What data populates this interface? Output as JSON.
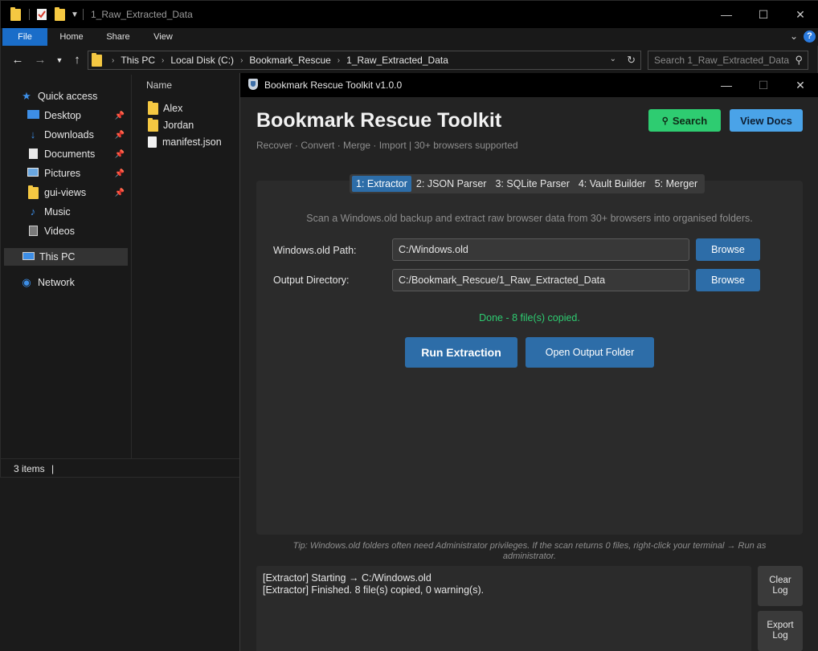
{
  "explorer": {
    "window_title": "1_Raw_Extracted_Data",
    "ribbon_tabs": [
      "File",
      "Home",
      "Share",
      "View"
    ],
    "help_glyph": "?",
    "breadcrumbs": [
      "This PC",
      "Local Disk (C:)",
      "Bookmark_Rescue",
      "1_Raw_Extracted_Data"
    ],
    "search_placeholder": "Search 1_Raw_Extracted_Data",
    "nav_items": [
      {
        "label": "Quick access",
        "icon": "star-icon"
      },
      {
        "label": "Desktop",
        "icon": "desktop-icon",
        "pinned": true
      },
      {
        "label": "Downloads",
        "icon": "download-icon",
        "pinned": true
      },
      {
        "label": "Documents",
        "icon": "document-icon",
        "pinned": true
      },
      {
        "label": "Pictures",
        "icon": "picture-icon",
        "pinned": true
      },
      {
        "label": "gui-views",
        "icon": "folder-icon",
        "pinned": true
      },
      {
        "label": "Music",
        "icon": "music-icon"
      },
      {
        "label": "Videos",
        "icon": "video-icon"
      },
      {
        "label": "This PC",
        "icon": "computer-icon",
        "selected": true
      },
      {
        "label": "Network",
        "icon": "network-icon"
      }
    ],
    "column_header": "Name",
    "files": [
      {
        "name": "Alex",
        "type": "folder"
      },
      {
        "name": "Jordan",
        "type": "folder"
      },
      {
        "name": "manifest.json",
        "type": "file"
      }
    ],
    "status": "3 items"
  },
  "toolkit": {
    "window_title": "Bookmark Rescue Toolkit v1.0.0",
    "app_title": "Bookmark Rescue Toolkit",
    "subtitle": "Recover · Convert · Merge · Import  |  30+ browsers supported",
    "search_label": "Search",
    "docs_label": "View Docs",
    "tabs": [
      "1: Extractor",
      "2: JSON Parser",
      "3: SQLite Parser",
      "4: Vault Builder",
      "5: Merger"
    ],
    "active_tab": 0,
    "description": "Scan a Windows.old backup and extract raw browser data from 30+ browsers into organised folders.",
    "fields": [
      {
        "label": "Windows.old Path:",
        "value": "C:/Windows.old",
        "button": "Browse"
      },
      {
        "label": "Output Directory:",
        "value": "C:/Bookmark_Rescue/1_Raw_Extracted_Data",
        "button": "Browse"
      }
    ],
    "status_message": "Done - 8 file(s) copied.",
    "run_label": "Run Extraction",
    "open_label": "Open Output Folder",
    "tip": "Tip: Windows.old folders often need Administrator privileges. If the scan returns 0 files, right-click your terminal → Run as administrator.",
    "log_lines": [
      "[Extractor] Starting → C:/Windows.old",
      "[Extractor] Finished. 8 file(s) copied, 0 warning(s)."
    ],
    "clear_log_label": "Clear\nLog",
    "export_log_label": "Export\nLog"
  },
  "colors": {
    "accent_blue": "#2d6da8",
    "search_green": "#2ecc71",
    "docs_blue": "#4aa3e8",
    "success_text": "#2ecc71",
    "file_tab": "#1a6dc9"
  }
}
